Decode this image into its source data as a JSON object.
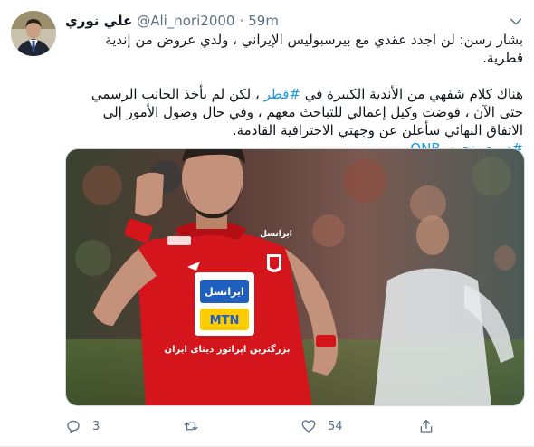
{
  "tweet": {
    "author_name": "علي نوري",
    "handle": "@Ali_nori2000",
    "separator": "·",
    "time": "59m",
    "lines": [
      "بشار رسن: لن اجدد عقدي مع بيرسبوليس الإيراني ، ولدي عروض من إندية قطرية."
    ],
    "para2_before": "هناك كلام شفهي من الأندية الكبيرة في ",
    "para2_tag": "#قطر",
    "para2_after": " ، لكن لم يأخذ الجانب الرسمي حتى الآن ، فوضت وكيل إعمالي للتباحث معهم ، وفي حال وصول الأمور إلى الاتفاق النهائي سأعلن عن وجهتي الاحترافية القادمة.",
    "hashtag_line": "#دوري_نجوم_QNB",
    "jersey_text": {
      "sponsor_top": "ایرانسل",
      "sponsor_bottom": "MTN",
      "chest_line": "بزرگترین اپراتور دیتای ایران",
      "sleeve_text": "ایرانسل"
    }
  },
  "actions": {
    "reply_count": "3",
    "retweet_count": "",
    "like_count": "54"
  },
  "colors": {
    "link": "#1b95e0",
    "secondary_text": "#5b7083",
    "jersey_red": "#d4151c"
  },
  "icons": [
    "chevron-down-icon",
    "reply-icon",
    "retweet-icon",
    "like-icon",
    "share-icon"
  ]
}
